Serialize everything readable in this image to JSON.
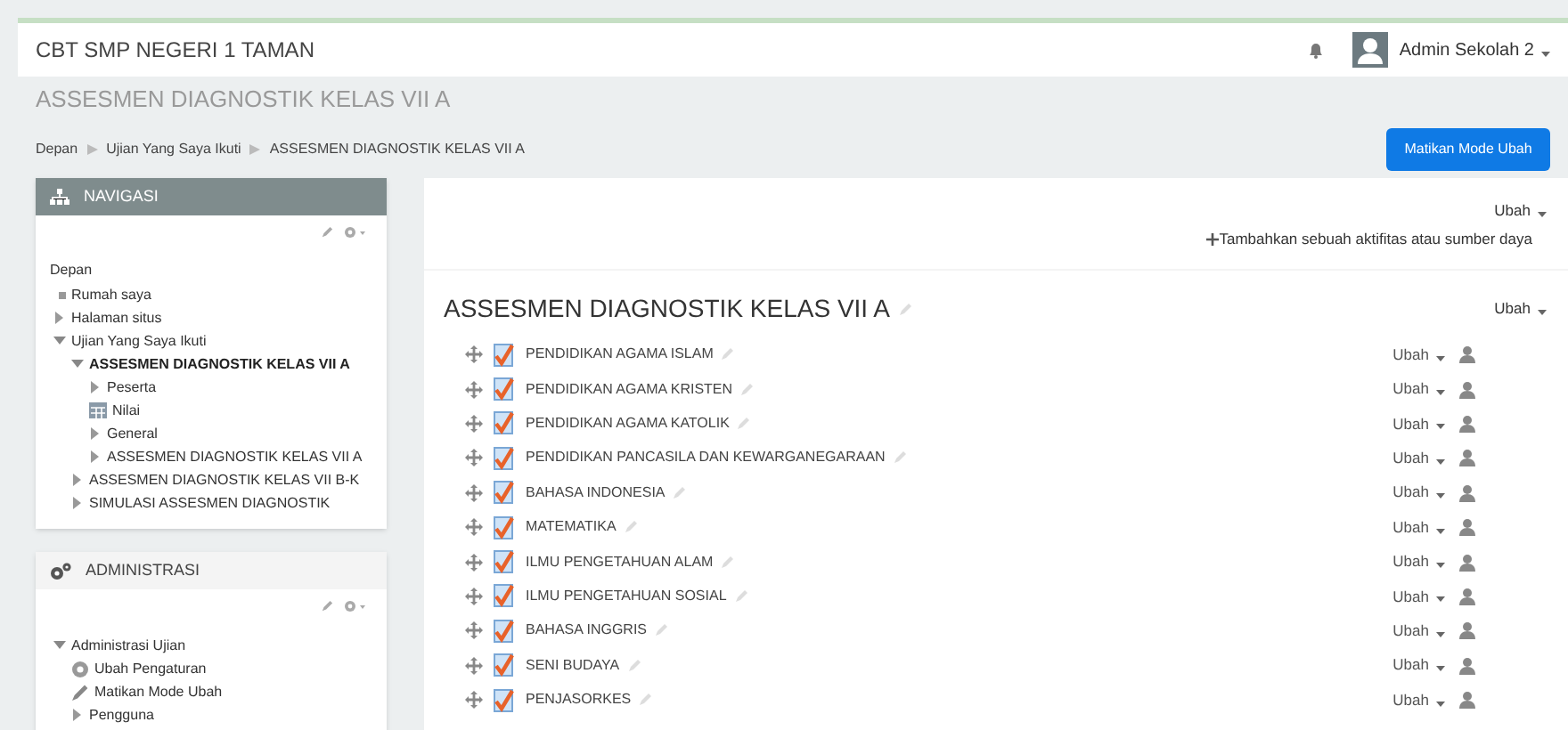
{
  "header": {
    "site_name": "CBT SMP NEGERI 1 TAMAN",
    "user_name": "Admin Sekolah 2"
  },
  "page_title": "ASSESMEN DIAGNOSTIK KELAS VII A",
  "breadcrumb": [
    "Depan",
    "Ujian Yang Saya Ikuti",
    "ASSESMEN DIAGNOSTIK KELAS VII A"
  ],
  "edit_mode_button": "Matikan Mode Ubah",
  "navigation": {
    "title": "NAVIGASI",
    "root": "Depan",
    "items": [
      {
        "label": "Rumah saya",
        "kind": "leaf"
      },
      {
        "label": "Halaman situs",
        "kind": "branch",
        "expanded": false
      },
      {
        "label": "Ujian Yang Saya Ikuti",
        "kind": "branch",
        "expanded": true,
        "children": [
          {
            "label": "ASSESMEN DIAGNOSTIK KELAS VII A",
            "kind": "branch",
            "expanded": true,
            "current": true,
            "children": [
              {
                "label": "Peserta",
                "kind": "branch",
                "expanded": false
              },
              {
                "label": "Nilai",
                "kind": "grades"
              },
              {
                "label": "General",
                "kind": "branch",
                "expanded": false
              },
              {
                "label": "ASSESMEN DIAGNOSTIK KELAS VII A",
                "kind": "branch",
                "expanded": false
              }
            ]
          },
          {
            "label": "ASSESMEN DIAGNOSTIK KELAS VII B-K",
            "kind": "branch",
            "expanded": false
          },
          {
            "label": "SIMULASI ASSESMEN DIAGNOSTIK",
            "kind": "branch",
            "expanded": false
          }
        ]
      }
    ]
  },
  "administration": {
    "title": "ADMINISTRASI",
    "items": [
      {
        "label": "Administrasi Ujian",
        "kind": "branch",
        "expanded": true,
        "children": [
          {
            "label": "Ubah Pengaturan",
            "kind": "settings"
          },
          {
            "label": "Matikan Mode Ubah",
            "kind": "edit"
          },
          {
            "label": "Pengguna",
            "kind": "branch",
            "expanded": false
          }
        ]
      }
    ]
  },
  "top_section": {
    "edit_menu": "Ubah",
    "add_link": "Tambahkan sebuah aktifitas atau sumber daya"
  },
  "section": {
    "title": "ASSESMEN DIAGNOSTIK KELAS VII A",
    "edit_menu": "Ubah",
    "activities": [
      {
        "name": "PENDIDIKAN AGAMA ISLAM",
        "edit_menu": "Ubah"
      },
      {
        "name": "PENDIDIKAN AGAMA KRISTEN",
        "edit_menu": "Ubah"
      },
      {
        "name": "PENDIDIKAN AGAMA KATOLIK",
        "edit_menu": "Ubah"
      },
      {
        "name": "PENDIDIKAN PANCASILA DAN KEWARGANEGARAAN",
        "edit_menu": "Ubah"
      },
      {
        "name": "BAHASA INDONESIA",
        "edit_menu": "Ubah"
      },
      {
        "name": "MATEMATIKA",
        "edit_menu": "Ubah"
      },
      {
        "name": "ILMU PENGETAHUAN ALAM",
        "edit_menu": "Ubah"
      },
      {
        "name": "ILMU PENGETAHUAN SOSIAL",
        "edit_menu": "Ubah"
      },
      {
        "name": "BAHASA INGGRIS",
        "edit_menu": "Ubah"
      },
      {
        "name": "SENI BUDAYA",
        "edit_menu": "Ubah"
      },
      {
        "name": "PENJASORKES",
        "edit_menu": "Ubah"
      }
    ]
  }
}
